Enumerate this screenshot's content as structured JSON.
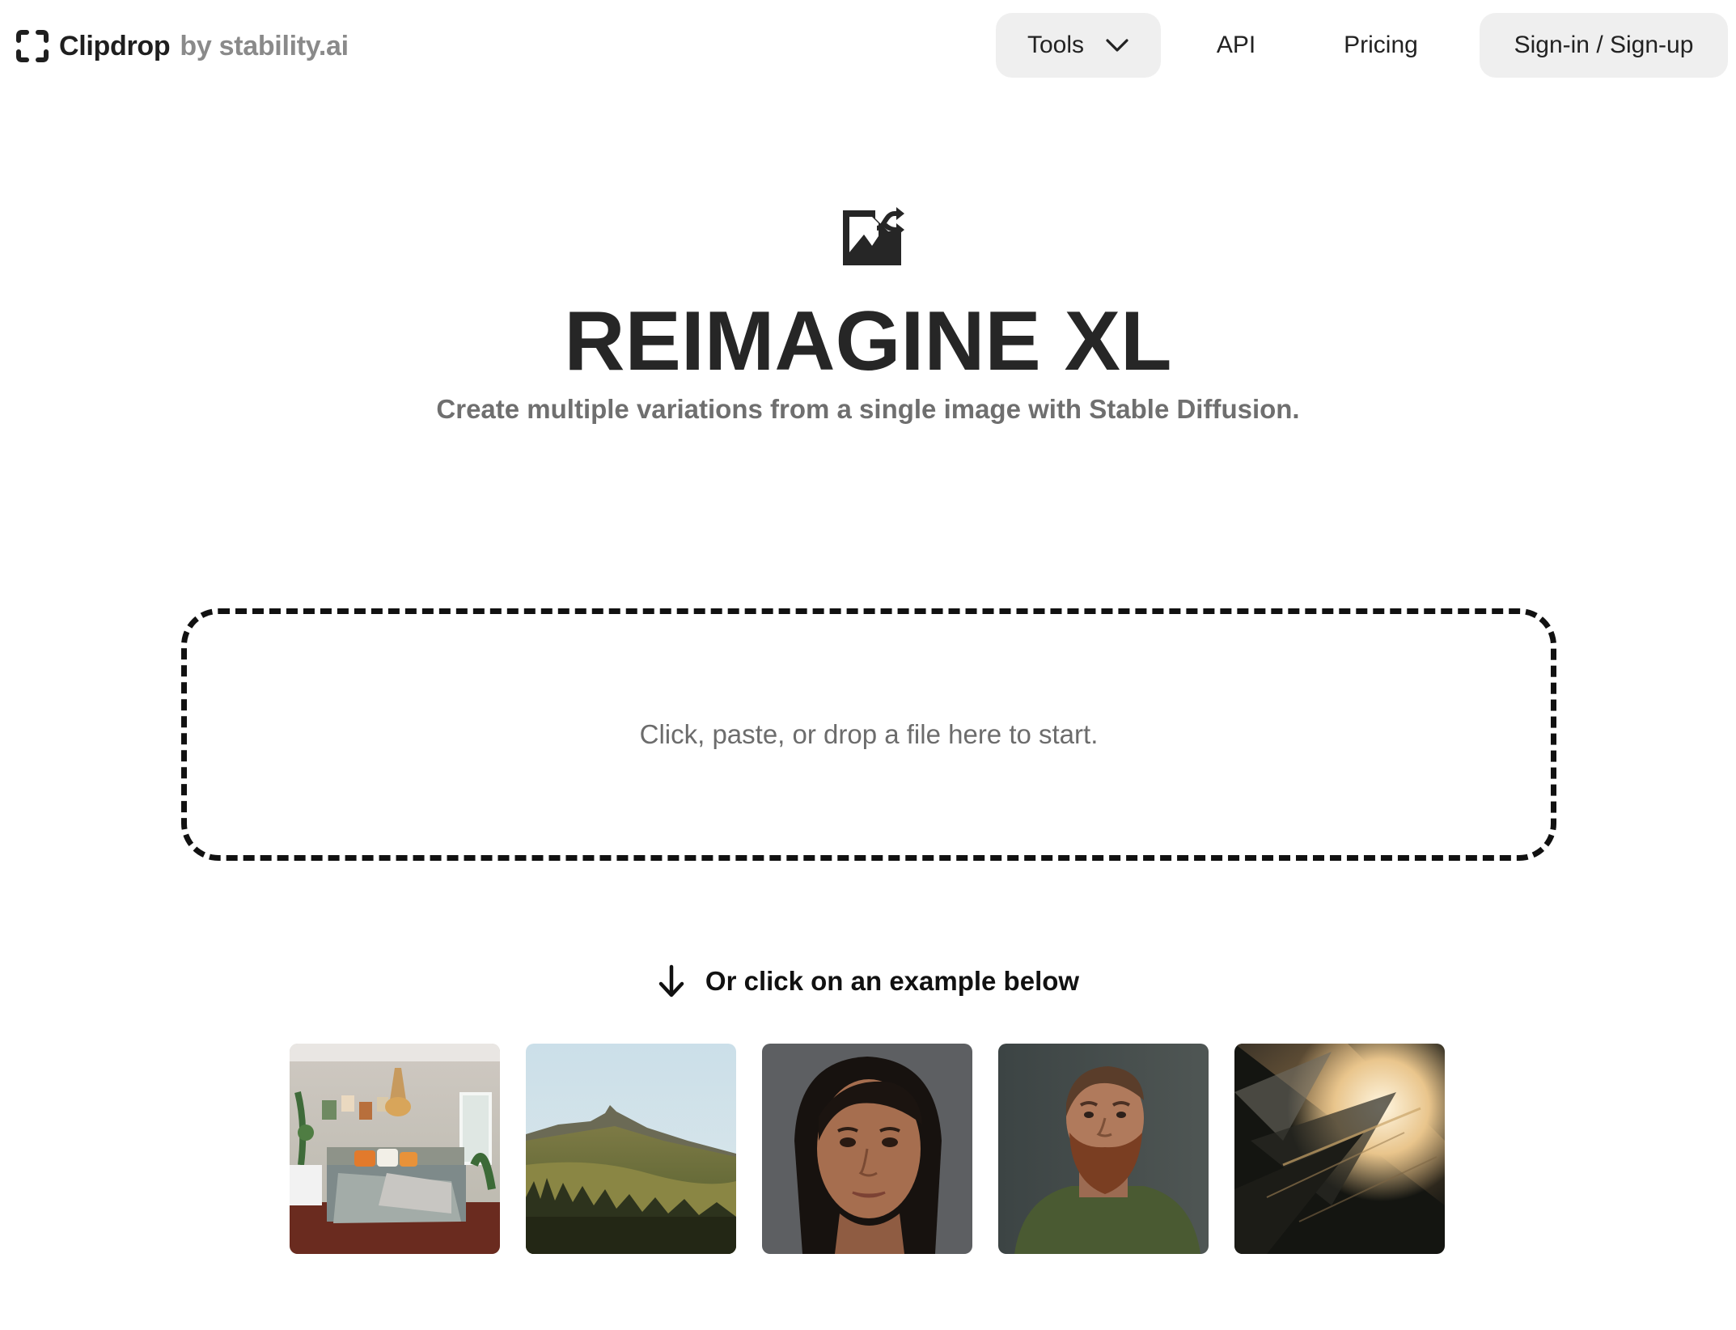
{
  "header": {
    "logo": {
      "name": "Clipdrop",
      "by": "by stability.ai"
    },
    "nav": {
      "tools_label": "Tools",
      "api_label": "API",
      "pricing_label": "Pricing",
      "signin_label": "Sign-in / Sign-up"
    }
  },
  "hero": {
    "icon": "image-shuffle-icon",
    "title": "REIMAGINE XL",
    "subtitle": "Create multiple variations from a single image with Stable Diffusion."
  },
  "dropzone": {
    "text": "Click, paste, or drop a file here to start."
  },
  "examples": {
    "hint": "Or click on an example below",
    "items": [
      {
        "subject": "bedroom interior"
      },
      {
        "subject": "mountain landscape"
      },
      {
        "subject": "portrait of a woman"
      },
      {
        "subject": "portrait of a bearded man"
      },
      {
        "subject": "abstract golden brush strokes"
      }
    ]
  },
  "colors": {
    "text_primary": "#262626",
    "text_muted": "#6f6f6f",
    "button_bg": "#efefef",
    "dash_border": "#111111"
  }
}
